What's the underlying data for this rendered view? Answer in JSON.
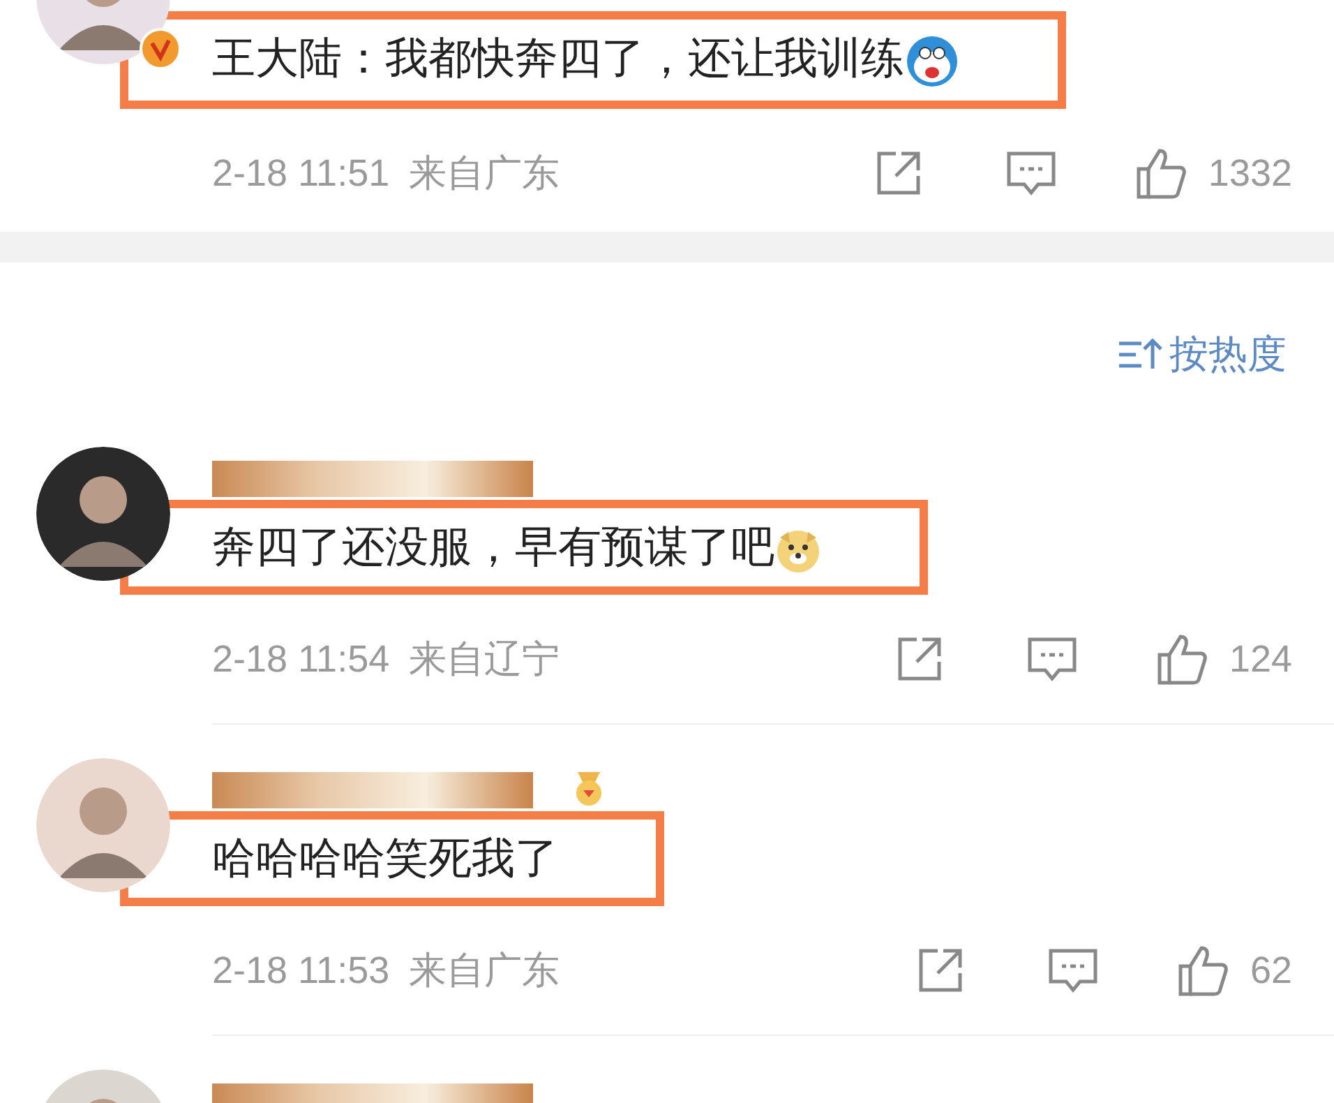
{
  "comments": [
    {
      "verified": true,
      "medal": false,
      "text": "王大陆：我都快奔四了，还让我训练",
      "emoji": {
        "kind": "cat"
      },
      "highlighted": true,
      "time": "2-18 11:51",
      "location": "来自广东",
      "likes": "1332"
    },
    {
      "sort_label": "按热度"
    },
    {
      "verified": false,
      "medal": false,
      "text": "奔四了还没服，早有预谋了吧",
      "emoji": {
        "kind": "dog"
      },
      "highlighted": true,
      "time": "2-18 11:54",
      "location": "来自辽宁",
      "likes": "124"
    },
    {
      "verified": false,
      "medal": true,
      "text": "哈哈哈哈笑死我了",
      "highlighted": true,
      "time": "2-18 11:53",
      "location": "来自广东",
      "likes": "62"
    },
    {
      "verified": false,
      "medal": false,
      "partial": true
    }
  ]
}
